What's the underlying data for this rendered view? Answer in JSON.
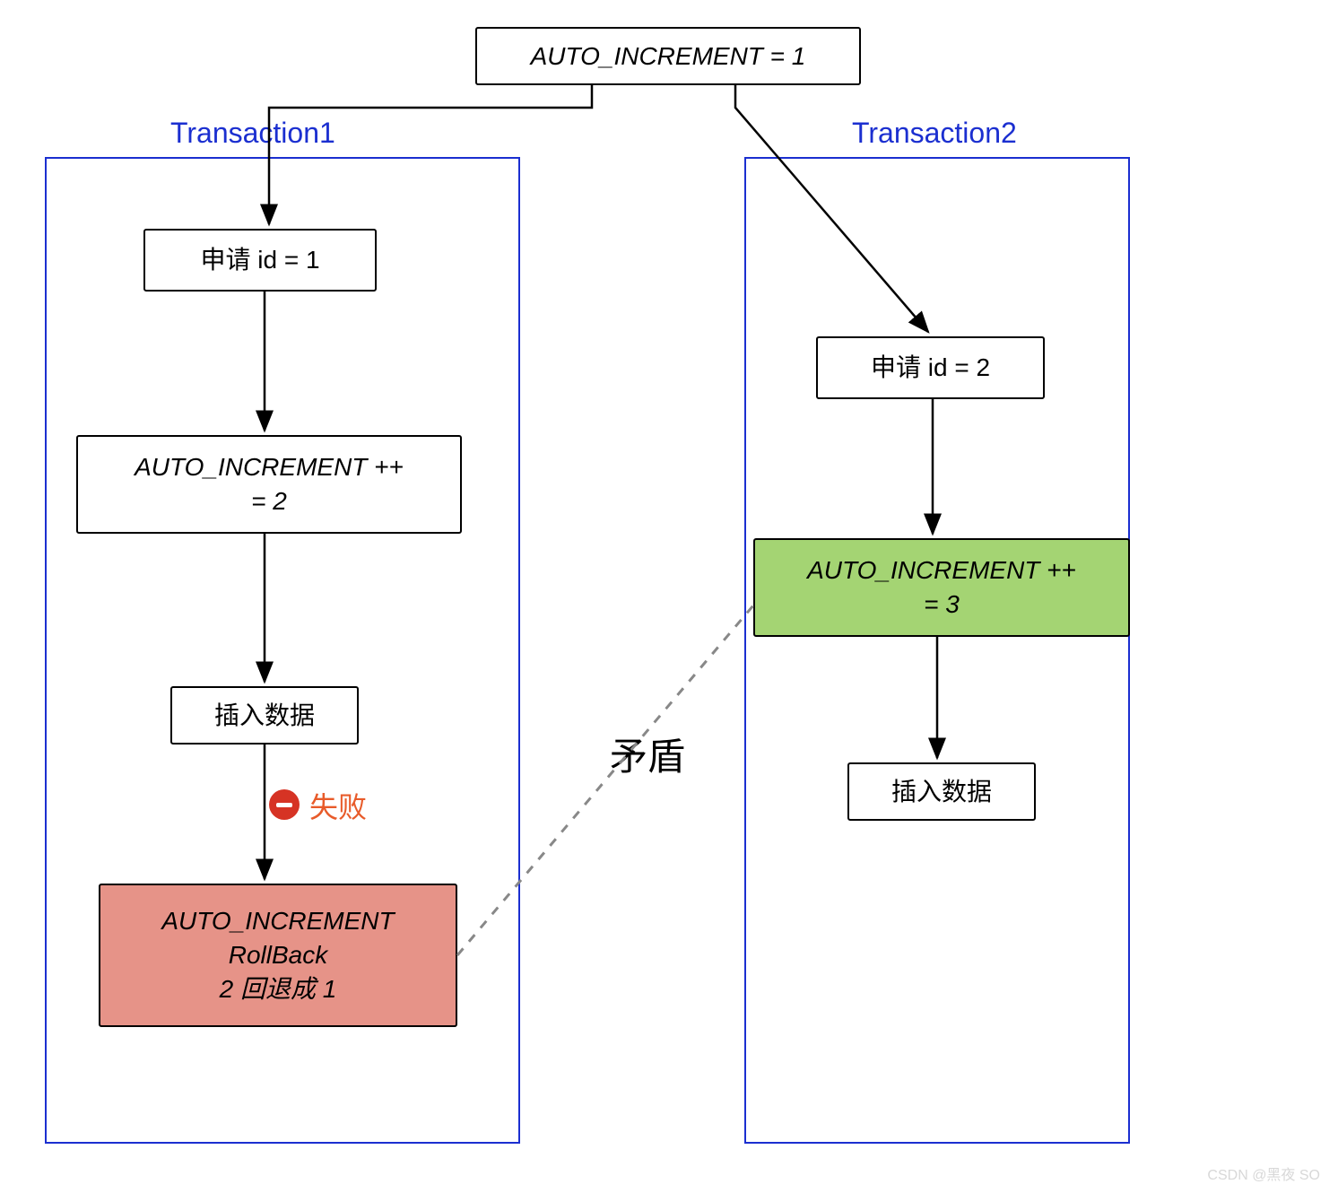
{
  "top_box": "AUTO_INCREMENT = 1",
  "transaction1": {
    "title": "Transaction1",
    "step1": "申请 id = 1",
    "step2": "AUTO_INCREMENT ++\n= 2",
    "step3": "插入数据",
    "fail_label": "失败",
    "step4": "AUTO_INCREMENT\nRollBack\n2 回退成 1"
  },
  "transaction2": {
    "title": "Transaction2",
    "step1": "申请 id = 2",
    "step2": "AUTO_INCREMENT ++\n= 3",
    "step3": "插入数据"
  },
  "conflict_label": "矛盾",
  "watermark": "CSDN @黑夜 SO",
  "colors": {
    "container_border": "#1b2fd0",
    "green_box": "#a4d473",
    "red_box": "#e69388",
    "fail_text": "#e85b2a"
  }
}
